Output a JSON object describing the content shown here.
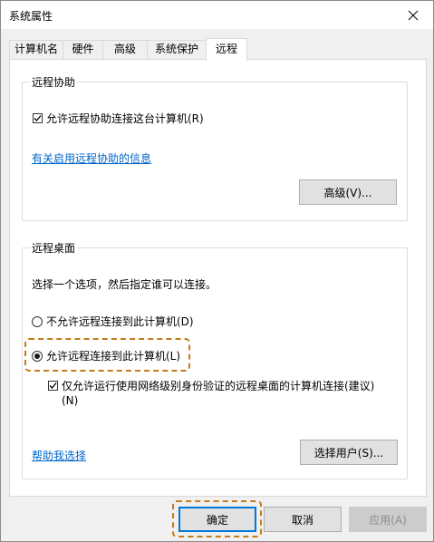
{
  "window": {
    "title": "系统属性"
  },
  "tabs": [
    {
      "label": "计算机名"
    },
    {
      "label": "硬件"
    },
    {
      "label": "高级"
    },
    {
      "label": "系统保护"
    },
    {
      "label": "远程",
      "active": true
    }
  ],
  "remote_assistance": {
    "title": "远程协助",
    "allow_label": "允许远程协助连接这台计算机(R)",
    "allow_checked": true,
    "info_link": "有关启用远程协助的信息",
    "advanced_button": "高级(V)..."
  },
  "remote_desktop": {
    "title": "远程桌面",
    "instruction": "选择一个选项，然后指定谁可以连接。",
    "option_deny": "不允许远程连接到此计算机(D)",
    "option_allow": "允许远程连接到此计算机(L)",
    "selected_option": "allow",
    "nla_label_line1": "仅允许运行使用网络级别身份验证的远程桌面的计算机连接(建议)",
    "nla_label_line2": "(N)",
    "nla_checked": true,
    "help_link": "帮助我选择",
    "select_users_button": "选择用户(S)..."
  },
  "footer": {
    "ok_button": "确定",
    "cancel_button": "取消",
    "apply_button": "应用(A)"
  },
  "colors": {
    "link": "#0066cc",
    "highlight": "#c57b1a",
    "default_button_border": "#0078d7"
  }
}
